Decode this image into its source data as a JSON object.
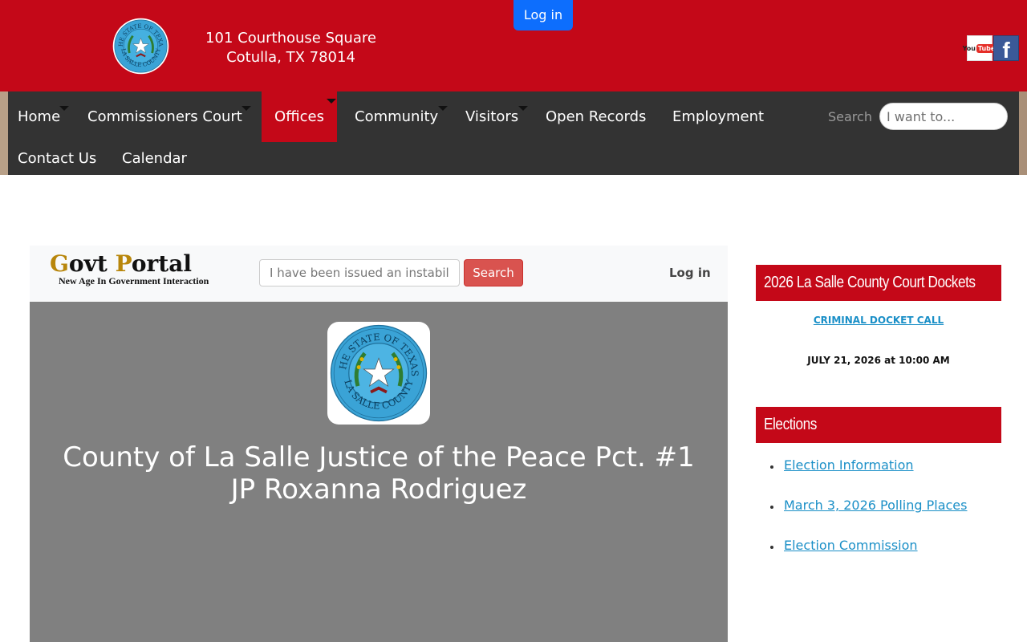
{
  "header": {
    "address_line1": "101 Courthouse Square",
    "address_line2": "Cotulla, TX 78014",
    "login_label": "Log in",
    "youtube_text": "You",
    "youtube_tube": "Tube",
    "facebook_glyph": "f"
  },
  "nav": {
    "items": [
      {
        "label": "Home"
      },
      {
        "label": "Commissioners Court"
      },
      {
        "label": "Offices"
      },
      {
        "label": "Community"
      },
      {
        "label": "Visitors"
      },
      {
        "label": "Open Records"
      },
      {
        "label": "Employment"
      },
      {
        "label": "Contact Us"
      },
      {
        "label": "Calendar"
      }
    ],
    "active": "Offices",
    "search_label": "Search",
    "search_placeholder": "I want to..."
  },
  "portal": {
    "logo_g": "G",
    "logo_ovt": "ovt ",
    "logo_p": "P",
    "logo_ortal": "ortal",
    "logo_tagline": "New Age In Government Interaction",
    "search_placeholder": "I have been issued an instabill c",
    "search_button": "Search",
    "login_label": "Log in"
  },
  "hero": {
    "title_line1": "County of La Salle Justice of the Peace Pct. #1",
    "title_line2": "JP Roxanna Rodriguez"
  },
  "seal": {
    "top_text": "THE STATE OF TEXAS",
    "bottom_text": "LA SALLE COUNTY"
  },
  "sidebar": {
    "dockets_heading": "2026 La Salle County Court Dockets",
    "docket_link": "CRIMINAL DOCKET CALL",
    "docket_date": "JULY 21, 2026 at 10:00 AM",
    "elections_heading": "Elections",
    "election_links": [
      "Election Information",
      "March 3, 2026 Polling Places",
      "Election Commission"
    ]
  },
  "colors": {
    "brand_red": "#c40818",
    "nav_dark": "#333333",
    "link_blue": "#1a8fc7",
    "login_blue": "#0d6efd"
  }
}
